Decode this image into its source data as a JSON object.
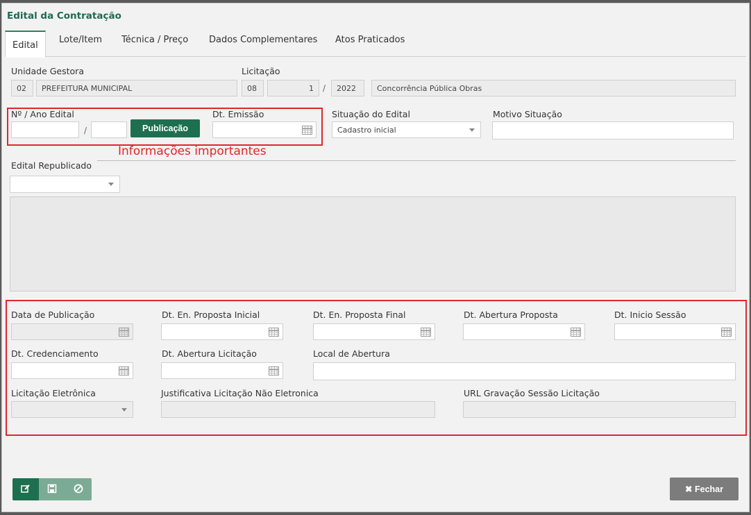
{
  "dialog": {
    "title": "Edital da Contratação"
  },
  "tabs": [
    "Edital",
    "Lote/Item",
    "Técnica / Preço",
    "Dados Complementares",
    "Atos Praticados"
  ],
  "unidade": {
    "label": "Unidade Gestora",
    "code": "02",
    "name": "PREFEITURA MUNICIPAL"
  },
  "licitacao": {
    "label": "Licitação",
    "code": "08",
    "number": "1",
    "year": "2022",
    "desc": "Concorrência Pública Obras",
    "sep": "/"
  },
  "edital": {
    "label": "Nº / Ano Edital",
    "number": "",
    "year": "",
    "sep": "/"
  },
  "publicacao_btn": "Publicação",
  "dt_emissao": {
    "label": "Dt. Emissão",
    "value": ""
  },
  "situacao": {
    "label": "Situação do Edital",
    "value": "Cadastro inicial"
  },
  "motivo": {
    "label": "Motivo Situação",
    "value": ""
  },
  "annotation": "Informações importantes",
  "republicado": {
    "label": "Edital Republicado",
    "value": ""
  },
  "dates": {
    "publicacao": "Data de Publicação",
    "proposta_inicial": "Dt. En. Proposta Inicial",
    "proposta_final": "Dt. En. Proposta Final",
    "abertura_proposta": "Dt. Abertura Proposta",
    "inicio_sessao": "Dt. Inicio Sessão",
    "credenciamento": "Dt. Credenciamento",
    "abertura_licitacao": "Dt. Abertura Licitação",
    "local_abertura": "Local de Abertura",
    "licitacao_eletronica": "Licitação Eletrônica",
    "justificativa": "Justificativa Licitação Não Eletronica",
    "url_gravacao": "URL Gravação Sessão Licitação"
  },
  "footer": {
    "fechar": "Fechar"
  },
  "icons": {
    "edit": "edit-icon",
    "save": "floppy-icon",
    "cancel": "ban-icon",
    "close": "x-icon",
    "calendar": "calendar-icon",
    "dropdown": "chevron-down-icon"
  },
  "colors": {
    "accent": "#1e6f4f",
    "highlight": "#e0262c"
  }
}
